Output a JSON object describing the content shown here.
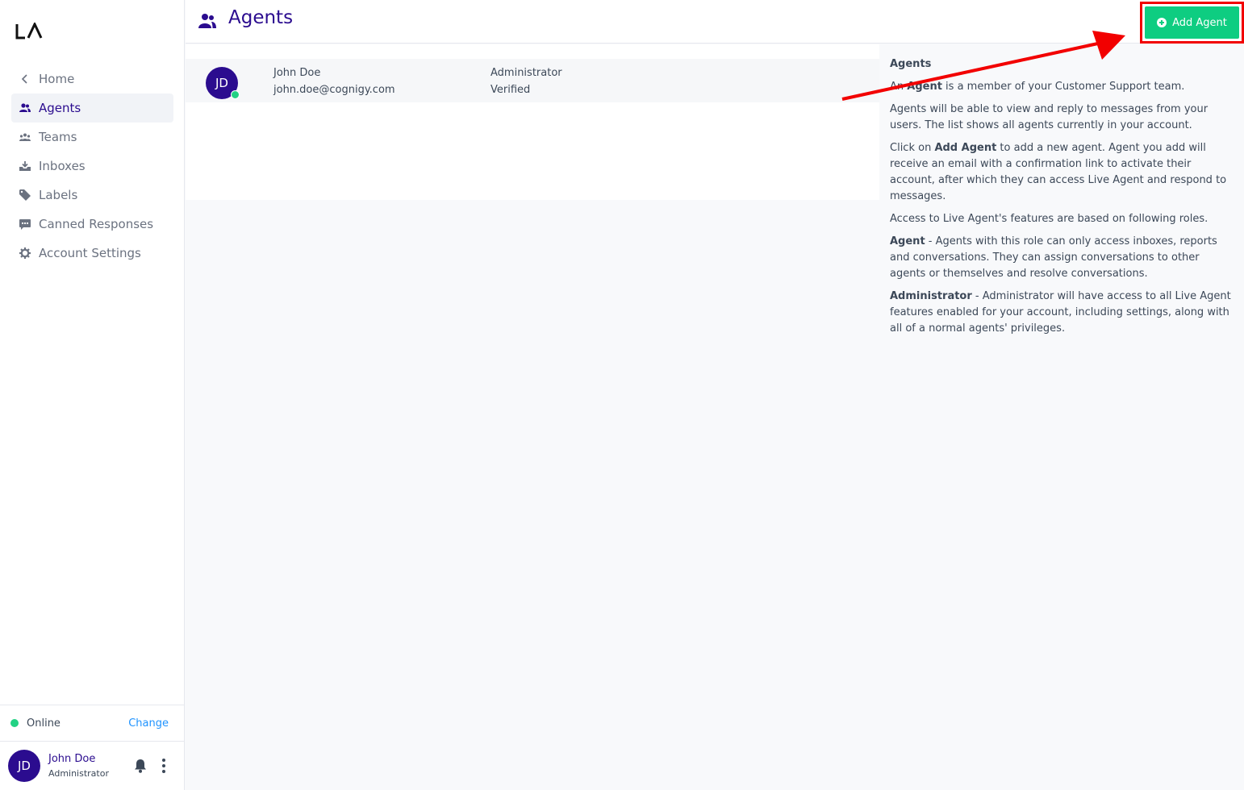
{
  "app": {
    "logo_text": "LA"
  },
  "sidebar": {
    "items": [
      {
        "label": "Home",
        "icon": "chevron-left-icon"
      },
      {
        "label": "Agents",
        "icon": "agents-icon"
      },
      {
        "label": "Teams",
        "icon": "teams-icon"
      },
      {
        "label": "Inboxes",
        "icon": "inbox-icon"
      },
      {
        "label": "Labels",
        "icon": "tag-icon"
      },
      {
        "label": "Canned Responses",
        "icon": "chat-bubble-icon"
      },
      {
        "label": "Account Settings",
        "icon": "gear-icon"
      }
    ],
    "status": {
      "label": "Online",
      "change_label": "Change"
    },
    "profile": {
      "initials": "JD",
      "name": "John Doe",
      "role": "Administrator"
    }
  },
  "header": {
    "title": "Agents",
    "add_button_label": "Add Agent"
  },
  "agents": [
    {
      "initials": "JD",
      "name": "John Doe",
      "email": "john.doe@cognigy.com",
      "role": "Administrator",
      "status": "Verified"
    }
  ],
  "help": {
    "title": "Agents",
    "p1_prefix": "An ",
    "p1_bold": "Agent",
    "p1_rest": " is a member of your Customer Support team.",
    "p2": "Agents will be able to view and reply to messages from your users. The list shows all agents currently in your account.",
    "p3_prefix": "Click on ",
    "p3_bold": "Add Agent",
    "p3_rest": " to add a new agent. Agent you add will receive an email with a confirmation link to activate their account, after which they can access Live Agent and respond to messages.",
    "p4": "Access to Live Agent's features are based on following roles.",
    "p5_bold": "Agent",
    "p5_rest": " - Agents with this role can only access inboxes, reports and conversations. They can assign conversations to other agents or themselves and resolve conversations.",
    "p6_bold": "Administrator",
    "p6_rest": " - Administrator will have access to all Live Agent features enabled for your account, including settings, along with all of a normal agents' privileges."
  },
  "colors": {
    "brand": "#2b0c8f",
    "accent_green": "#0ecd81",
    "online": "#22d284",
    "link": "#1f93ff",
    "annotation_red": "#f20000"
  }
}
